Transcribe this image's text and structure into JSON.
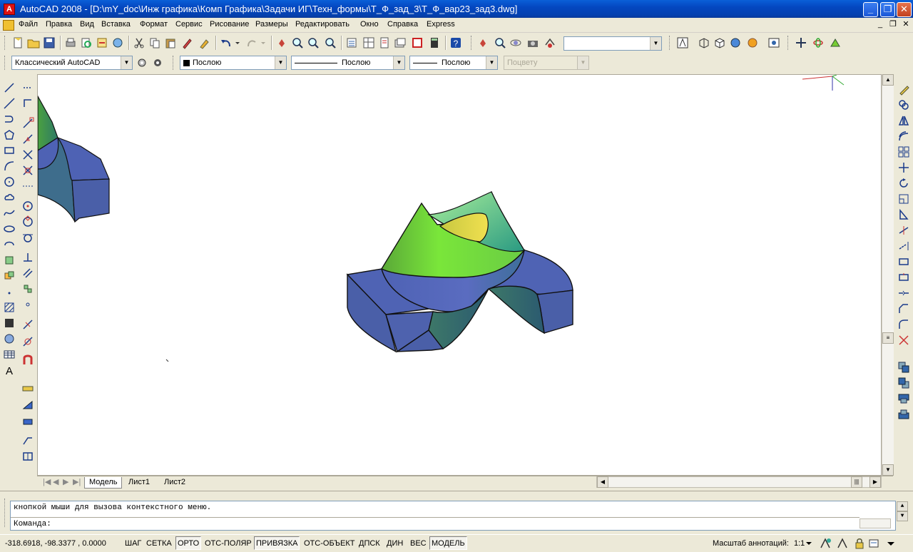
{
  "window": {
    "title": "AutoCAD 2008 - [D:\\mY_doc\\Инж графика\\Комп Графика\\Задачи ИГ\\Техн_формы\\Т_Ф_зад_3\\Т_Ф_вар23_зад3.dwg]",
    "minimize": "_",
    "restore": "❐",
    "close": "✕"
  },
  "menu": {
    "items": [
      "Файл",
      "Правка",
      "Вид",
      "Вставка",
      "Формат",
      "Сервис",
      "Рисование",
      "Размеры",
      "Редактировать",
      "Окно",
      "Справка",
      "Express"
    ],
    "mdi_minimize": "_",
    "mdi_restore": "❐",
    "mdi_close": "✕"
  },
  "toolbar2": {
    "workspace": "Классический AutoCAD",
    "layer": "Послою",
    "linetype": "Послою",
    "lineweight": "Послою",
    "plotstyle": "Поцвету"
  },
  "tabs": [
    "Модель",
    "Лист1",
    "Лист2"
  ],
  "command": {
    "history": "кнопкой мыши для вызова контекстного меню.",
    "prompt": "Команда:"
  },
  "status": {
    "coords": "-318.6918, -98.3377 , 0.0000",
    "buttons": [
      {
        "label": "ШАГ",
        "on": false
      },
      {
        "label": "СЕТКА",
        "on": false
      },
      {
        "label": "ОРТО",
        "on": true
      },
      {
        "label": "ОТС-ПОЛЯР",
        "on": false
      },
      {
        "label": "ПРИВЯЗКА",
        "on": true
      },
      {
        "label": "ОТС-ОБЪЕКТ",
        "on": false
      },
      {
        "label": "ДПСК",
        "on": false
      },
      {
        "label": "ДИН",
        "on": false
      },
      {
        "label": "ВЕС",
        "on": false
      },
      {
        "label": "МОДЕЛЬ",
        "on": true
      }
    ],
    "annotation_scale_label": "Масштаб аннотаций:",
    "annotation_scale": "1:1"
  },
  "colors": {
    "title_blue": "#0447c0",
    "solid_blue": "#4e62b4",
    "solid_green": "#7ae63a",
    "solid_teal": "#3a8a78",
    "solid_yellow": "#e0d24a"
  }
}
